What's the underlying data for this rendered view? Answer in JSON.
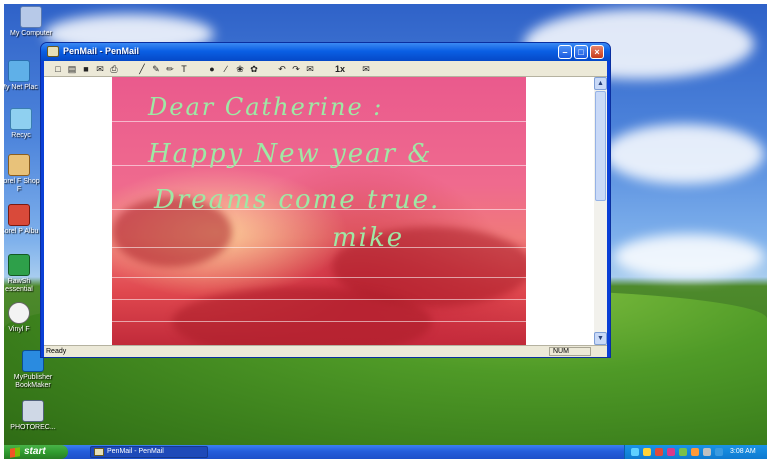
{
  "desktop": {
    "icons": [
      {
        "label": "My Computer"
      },
      {
        "label": "My Net Plac"
      },
      {
        "label": "Recyc"
      },
      {
        "label": "Corel F Shop F"
      },
      {
        "label": "Corel P Albu"
      },
      {
        "label": "RawSh essential"
      },
      {
        "label": "Vinyl F"
      },
      {
        "label": "MyPublisher BookMaker"
      },
      {
        "label": "PHOTOREC..."
      }
    ]
  },
  "window": {
    "title": "PenMail - PenMail",
    "controls": {
      "minimize": "–",
      "maximize": "□",
      "close": "×"
    },
    "toolbar": [
      "new-icon",
      "open-icon",
      "save-icon",
      "envelope-icon",
      "print-icon",
      "pen-icon",
      "marker-icon",
      "brush-icon",
      "text-icon",
      "dot-icon",
      "line-icon",
      "stamp-icon",
      "sticker-icon",
      "undo-icon",
      "redo-icon",
      "gift-icon",
      "zoom-1x-icon",
      "mail-icon"
    ],
    "toolbar_glyphs": [
      "□",
      "▤",
      "■",
      "✉",
      "⎙",
      "╱",
      "✎",
      "✏",
      "T",
      "●",
      "∕",
      "❀",
      "✿",
      "↶",
      "↷",
      "✉",
      "1x",
      "✉"
    ],
    "letter": {
      "line1": "Dear Catherine :",
      "line2": "Happy New year  &",
      "line3": "Dreams come true.",
      "signature": "mike"
    },
    "scroll": {
      "up": "▲",
      "down": "▼"
    },
    "status": {
      "left": "Ready",
      "num": "NUM"
    }
  },
  "taskbar": {
    "start": "start",
    "task": "PenMail - PenMail",
    "clock": "3:08 AM"
  }
}
